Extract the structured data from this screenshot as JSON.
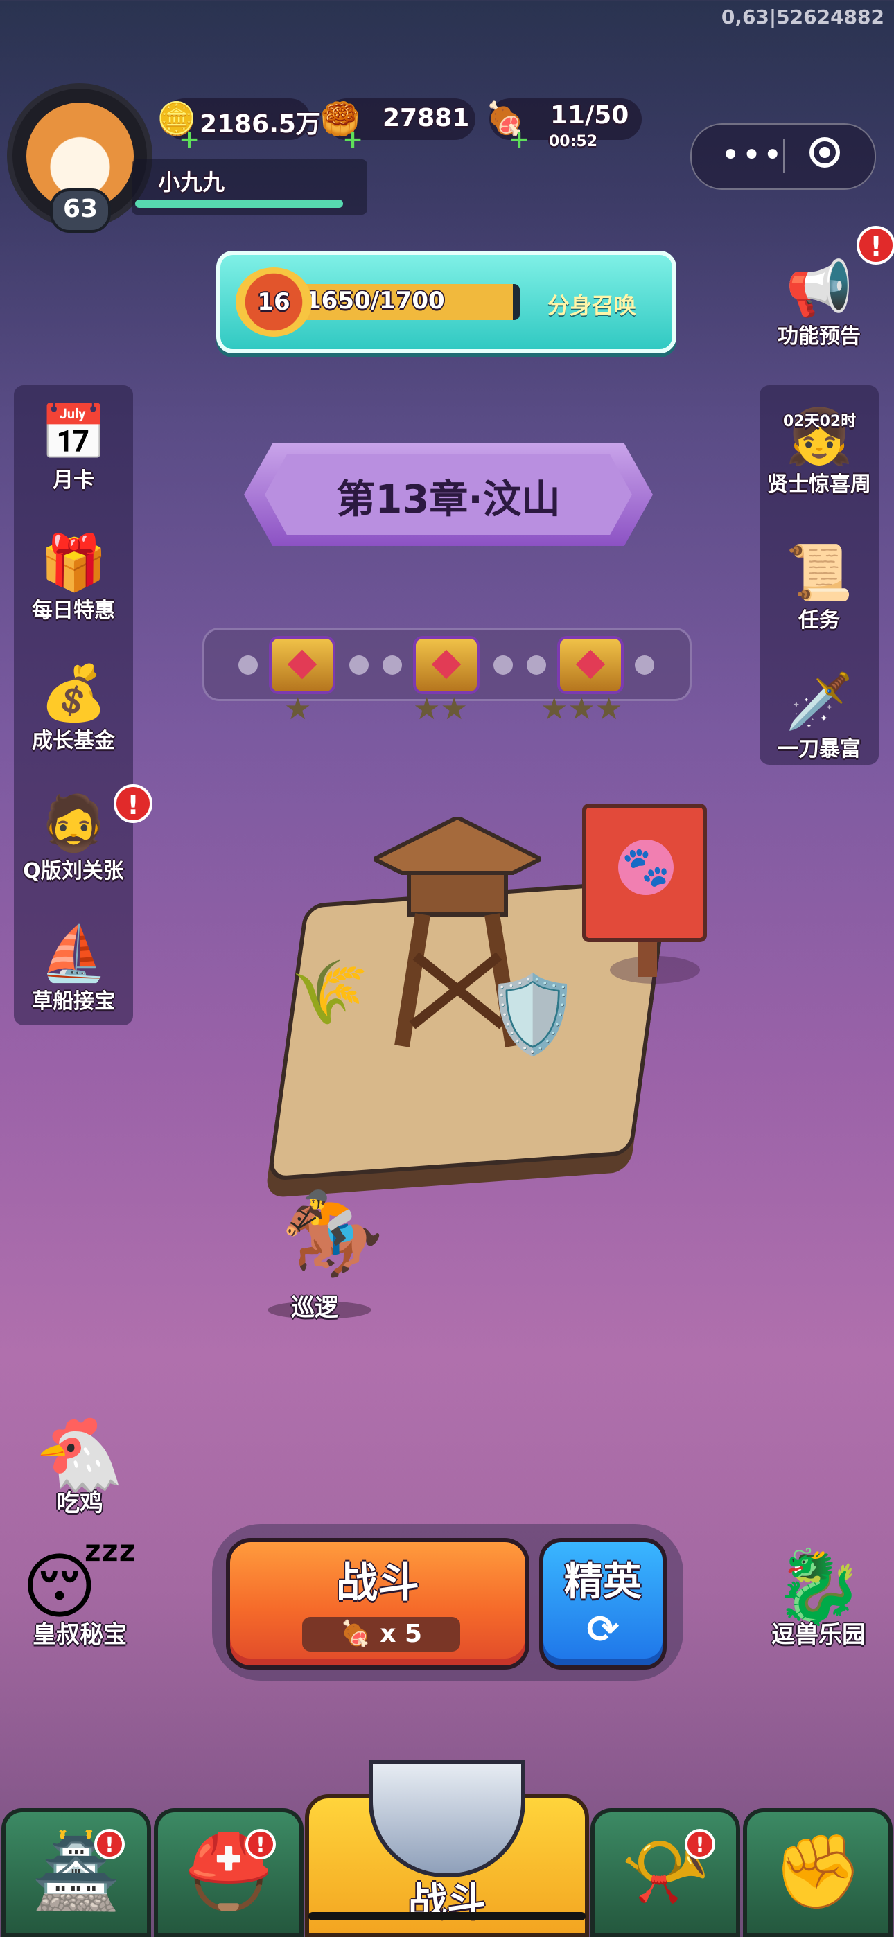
{
  "version_text": "0,63|52624882",
  "player": {
    "name": "小九九",
    "level": "63"
  },
  "resources": {
    "silver": {
      "icon": "silver-coin-icon",
      "value": "2186.5万"
    },
    "gold": {
      "icon": "gold-ingot-icon",
      "value": "27881"
    },
    "stamina": {
      "icon": "meat-icon",
      "value": "11/50",
      "timer": "00:52"
    }
  },
  "miniprogram_capsule": {
    "more": "•••",
    "close_icon": "target-icon"
  },
  "summon": {
    "level": "16",
    "progress_text": "1650/1700",
    "progress": 0.97,
    "label": "分身召唤"
  },
  "left_menu": [
    {
      "label": "月卡",
      "icon": "calendar-card-icon"
    },
    {
      "label": "每日特惠",
      "icon": "gift-bag-icon"
    },
    {
      "label": "成长基金",
      "icon": "fund-hero-icon"
    },
    {
      "label": "Q版刘关张",
      "icon": "three-heroes-icon",
      "badge": "!"
    },
    {
      "label": "草船接宝",
      "icon": "straw-boat-icon"
    }
  ],
  "right_menu": [
    {
      "label": "功能预告",
      "icon": "megaphone-girl-icon",
      "badge": "!"
    },
    {
      "label": "贤士惊喜周",
      "icon": "sage-girl-icon",
      "timer": "02天02时"
    },
    {
      "label": "任务",
      "icon": "scroll-icon"
    },
    {
      "label": "一刀暴富",
      "icon": "knife-treasure-icon"
    }
  ],
  "chapter": {
    "title": "第13章·汶山"
  },
  "star_track": {
    "chests": [
      {
        "stars": 1
      },
      {
        "stars": 2
      },
      {
        "stars": 3
      }
    ]
  },
  "map": {
    "hero_label": "巡逻"
  },
  "lower_left": [
    {
      "label": "吃鸡",
      "icon": "chicken-hero-icon"
    },
    {
      "label": "皇叔秘宝",
      "icon": "sleeping-uncle-icon"
    }
  ],
  "lower_right": {
    "label": "逗兽乐园",
    "icon": "beast-park-icon"
  },
  "battle": {
    "label": "战斗",
    "cost": "x 5",
    "elite_label": "精英",
    "elite_icon": "refresh-icon"
  },
  "bottom_nav": {
    "tabs": [
      {
        "icon": "palace-icon",
        "badge": "!"
      },
      {
        "icon": "helmet-icon",
        "badge": "!"
      },
      {
        "icon": "horn-stars-icon",
        "badge": "!"
      },
      {
        "icon": "fist-growth-icon"
      }
    ],
    "center_label": "战斗"
  }
}
